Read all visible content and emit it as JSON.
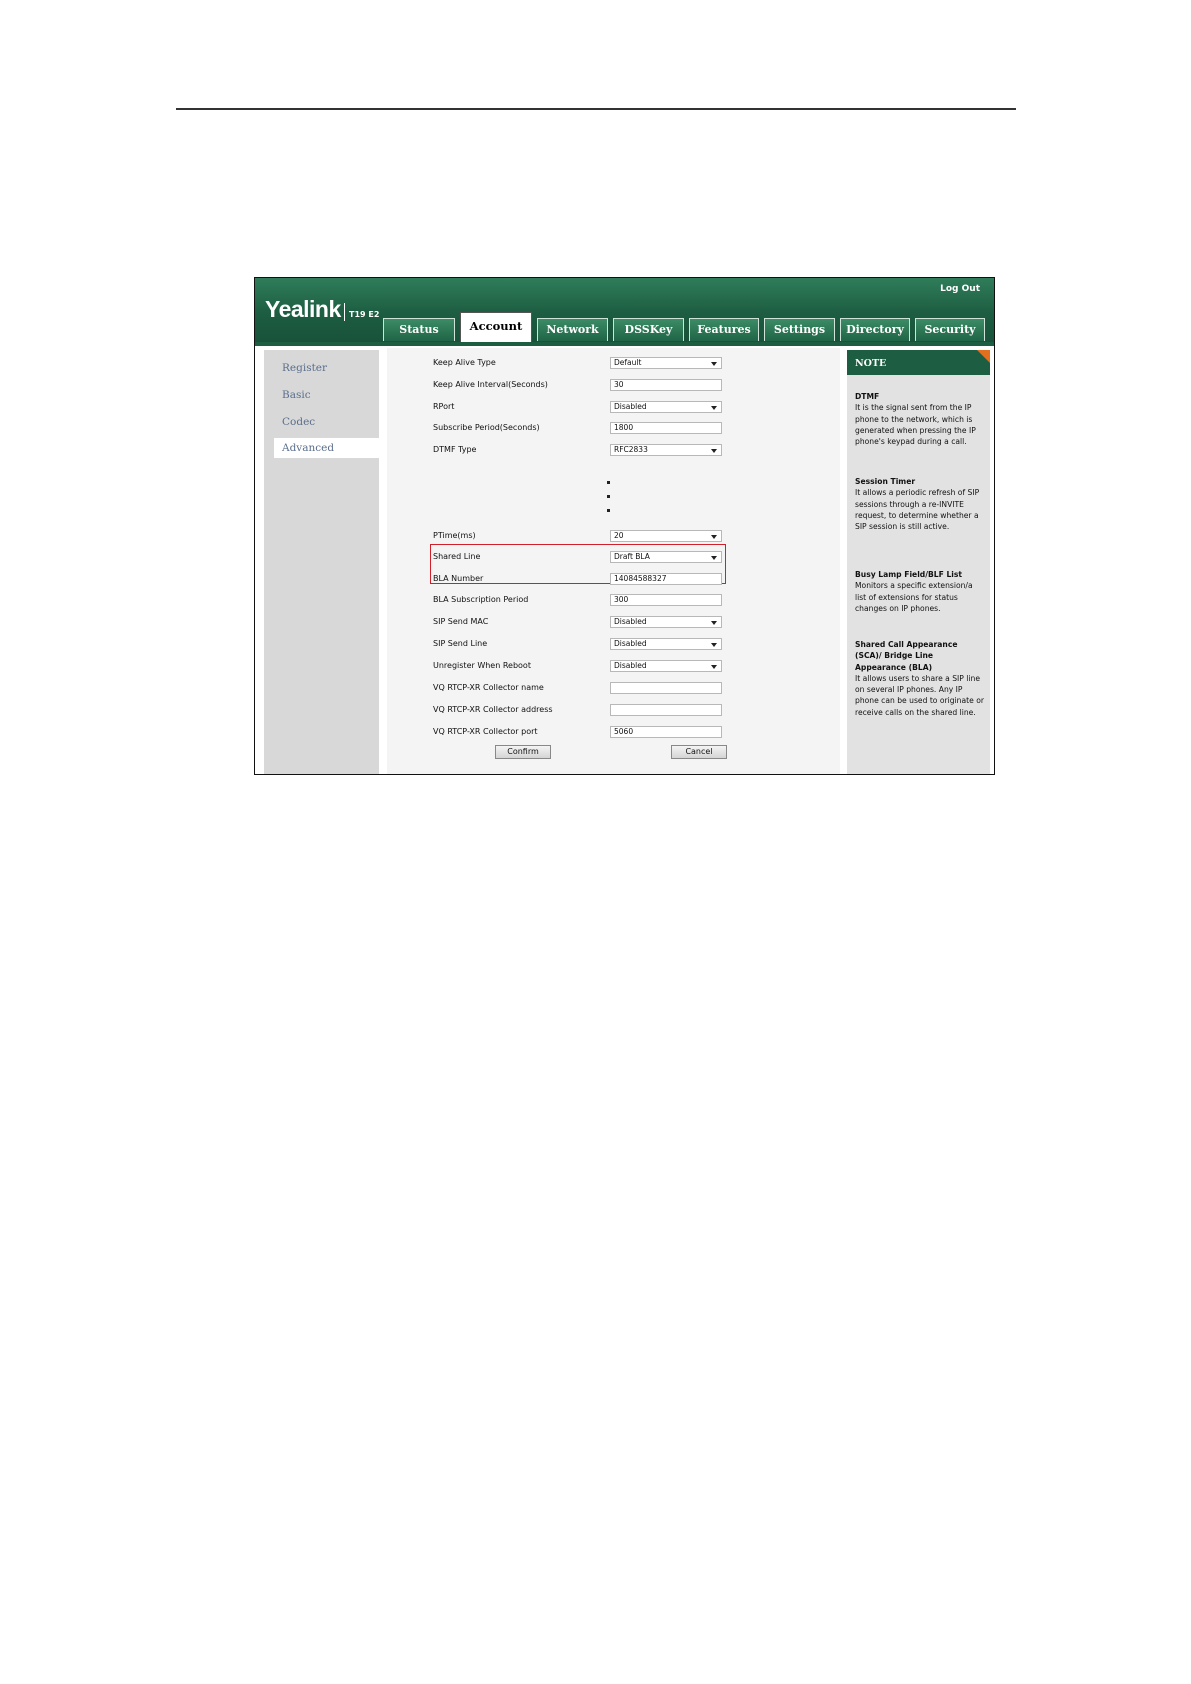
{
  "window": {
    "brand": "Yealink",
    "model": "T19 E2",
    "logout": "Log Out"
  },
  "tabs": [
    {
      "label": "Status"
    },
    {
      "label": "Account"
    },
    {
      "label": "Network"
    },
    {
      "label": "DSSKey"
    },
    {
      "label": "Features"
    },
    {
      "label": "Settings"
    },
    {
      "label": "Directory"
    },
    {
      "label": "Security"
    }
  ],
  "active_tab": "Account",
  "sidebar": {
    "items": [
      {
        "label": "Register"
      },
      {
        "label": "Basic"
      },
      {
        "label": "Codec"
      },
      {
        "label": "Advanced"
      }
    ],
    "active": "Advanced"
  },
  "form": {
    "rows": [
      {
        "label": "Keep Alive Type",
        "value": "Default",
        "type": "select"
      },
      {
        "label": "Keep Alive Interval(Seconds)",
        "value": "30",
        "type": "text"
      },
      {
        "label": "RPort",
        "value": "Disabled",
        "type": "select"
      },
      {
        "label": "Subscribe Period(Seconds)",
        "value": "1800",
        "type": "text"
      },
      {
        "label": "DTMF Type",
        "value": "RFC2833",
        "type": "select"
      },
      {
        "label": "PTime(ms)",
        "value": "20",
        "type": "select"
      },
      {
        "label": "Shared Line",
        "value": "Draft BLA",
        "type": "select"
      },
      {
        "label": "BLA Number",
        "value": "14084588327",
        "type": "text"
      },
      {
        "label": "BLA Subscription Period",
        "value": "300",
        "type": "text"
      },
      {
        "label": "SIP Send MAC",
        "value": "Disabled",
        "type": "select"
      },
      {
        "label": "SIP Send Line",
        "value": "Disabled",
        "type": "select"
      },
      {
        "label": "Unregister When Reboot",
        "value": "Disabled",
        "type": "select"
      },
      {
        "label": "VQ RTCP-XR Collector name",
        "value": "",
        "type": "text"
      },
      {
        "label": "VQ RTCP-XR Collector address",
        "value": "",
        "type": "text"
      },
      {
        "label": "VQ RTCP-XR Collector port",
        "value": "5060",
        "type": "text"
      }
    ],
    "confirm_label": "Confirm",
    "cancel_label": "Cancel"
  },
  "note": {
    "header": "NOTE",
    "blocks": [
      {
        "title": "DTMF",
        "text": "It is the signal sent from the IP phone to the network, which is generated when pressing the IP phone's keypad during a call."
      },
      {
        "title": "Session Timer",
        "text": "It allows a periodic refresh of SIP sessions through a re-INVITE request, to determine whether a SIP session is still active."
      },
      {
        "title": "Busy Lamp Field/BLF List",
        "text": "Monitors a specific extension/a list of extensions for status changes on IP phones."
      },
      {
        "title": "Shared Call Appearance (SCA)/ Bridge Line Appearance (BLA)",
        "text": "It allows users to share a SIP line on several IP phones. Any IP phone can be used to originate or receive calls on the shared line."
      }
    ]
  },
  "colors": {
    "header_green": "#1d5d41",
    "highlight_red": "#d0202a",
    "note_corner": "#e07020"
  }
}
